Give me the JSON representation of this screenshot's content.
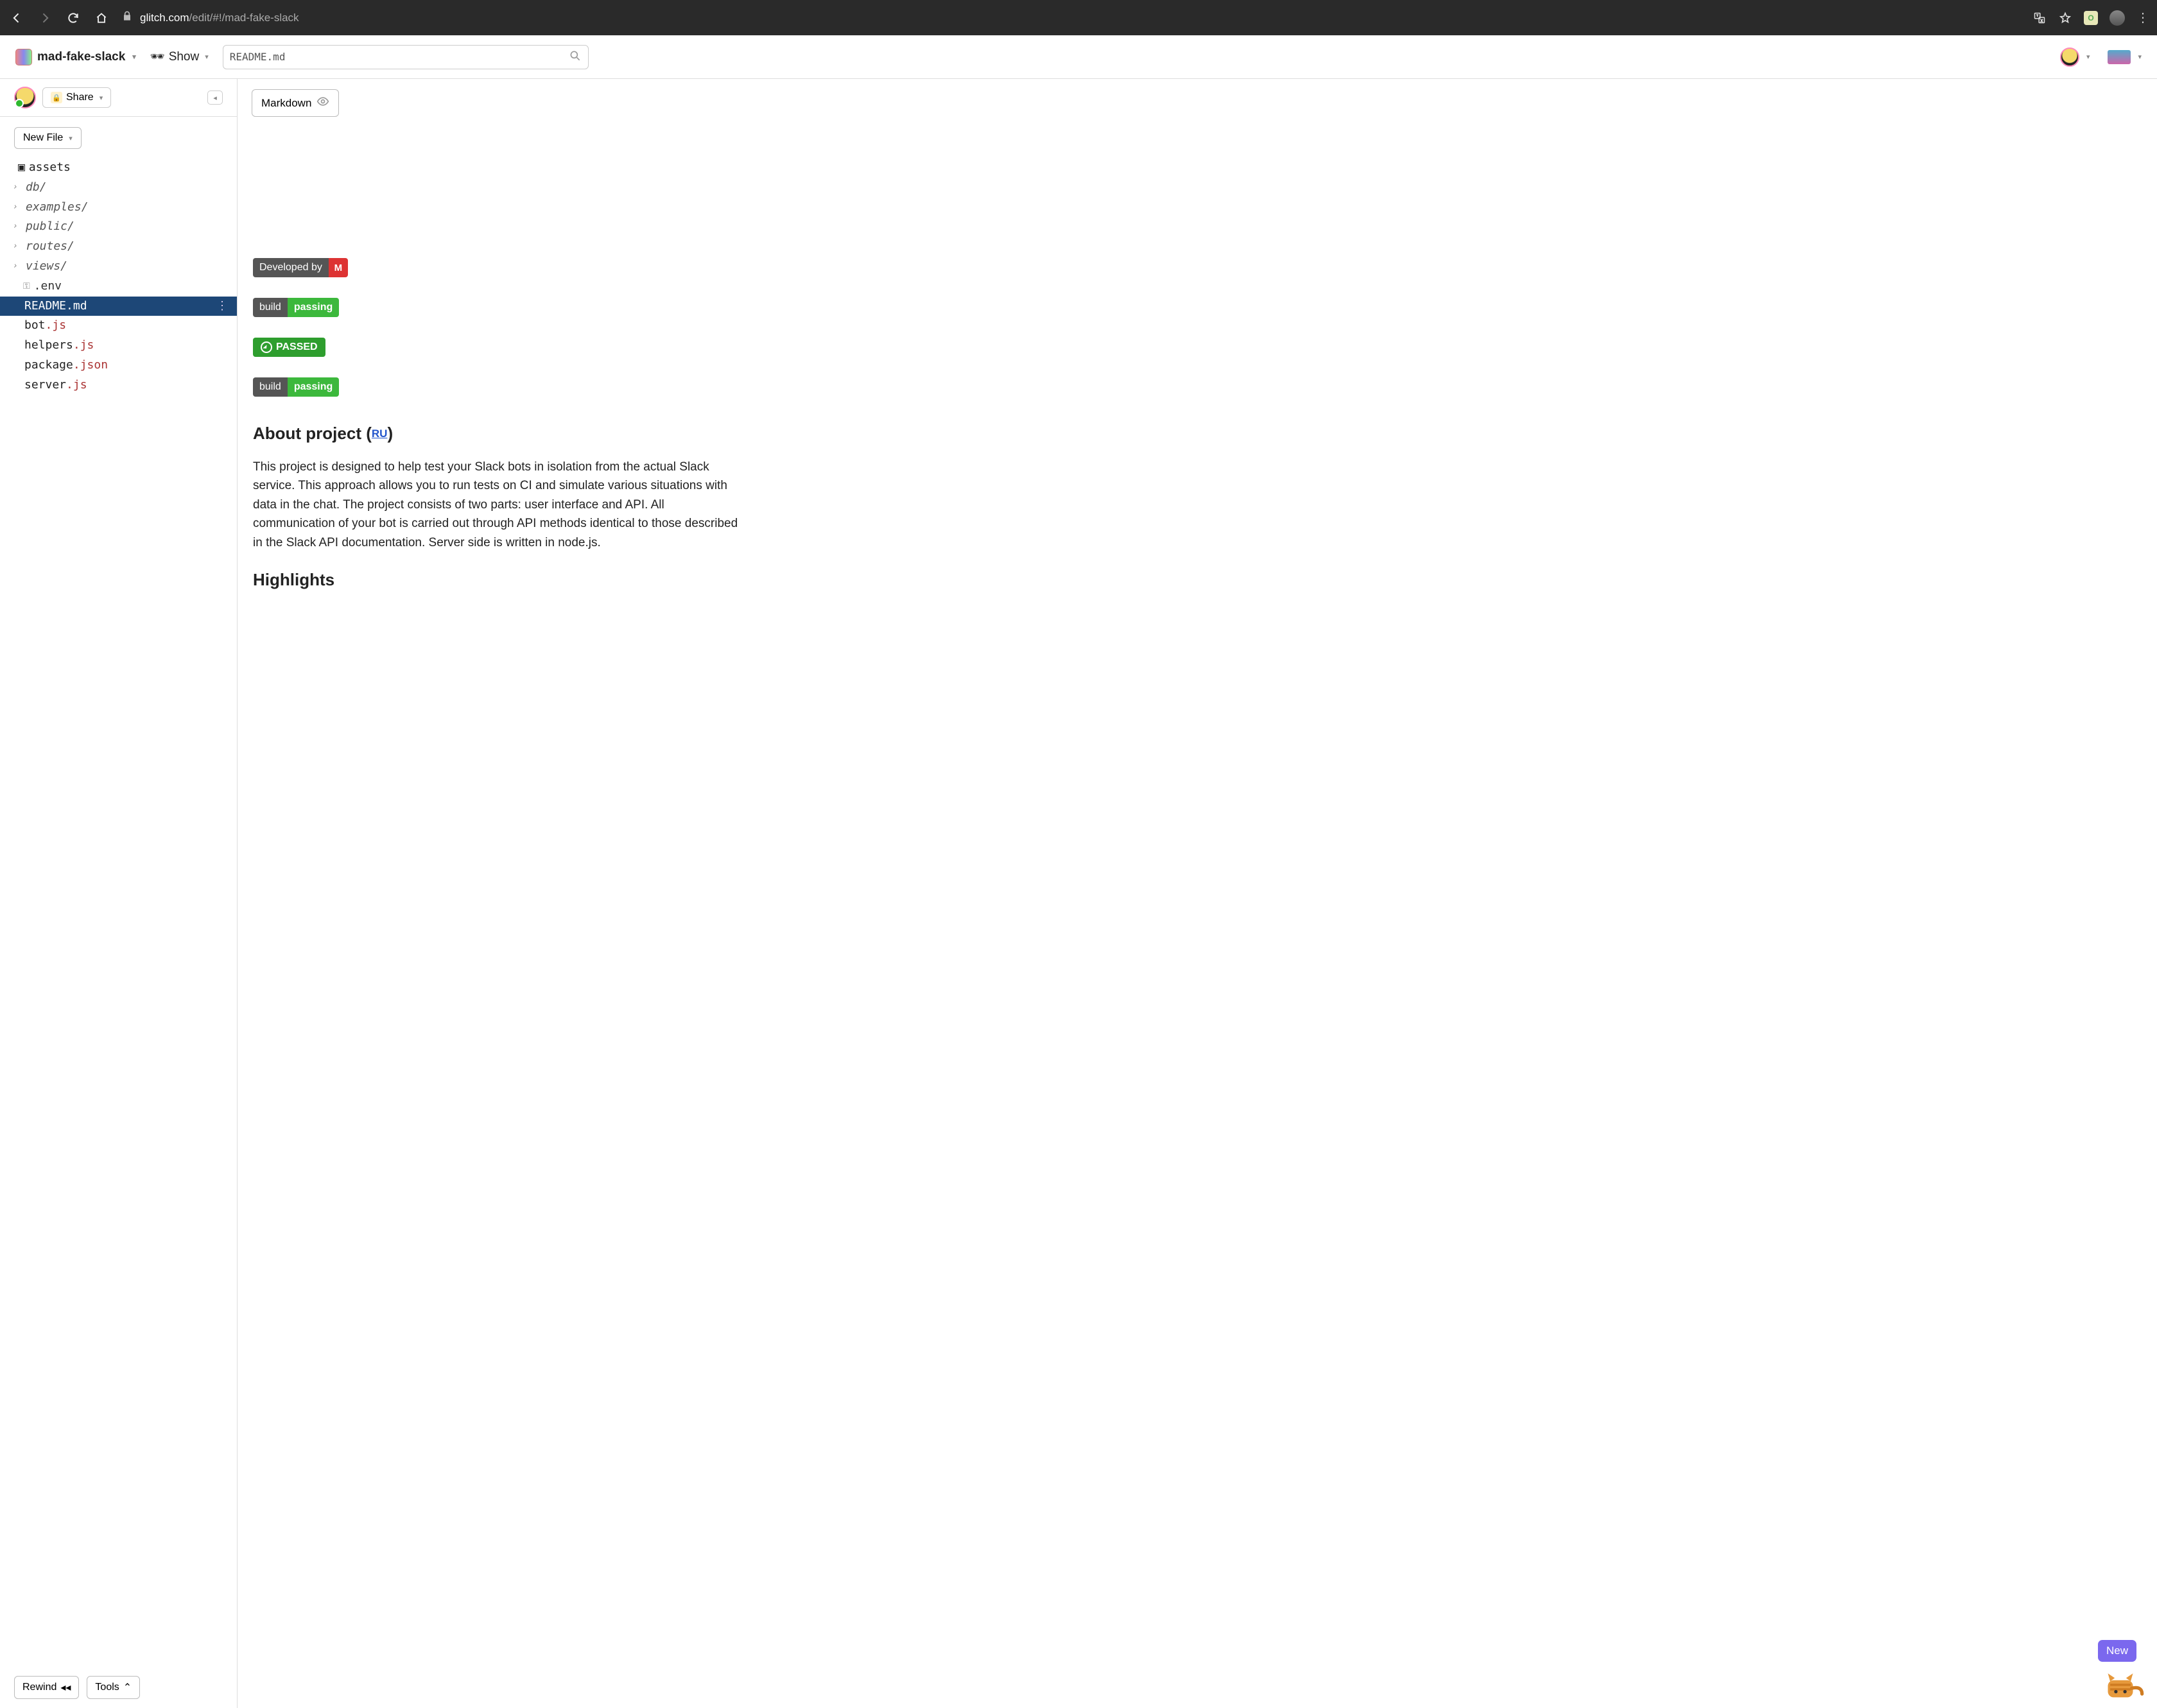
{
  "browser": {
    "url_domain": "glitch.com",
    "url_path": "/edit/#!/mad-fake-slack"
  },
  "app": {
    "project_name": "mad-fake-slack",
    "show_label": "Show",
    "search_value": "README.md"
  },
  "sidebar": {
    "share_label": "Share",
    "new_file_label": "New File",
    "tree": {
      "assets": "assets",
      "folders": [
        "db/",
        "examples/",
        "public/",
        "routes/",
        "views/"
      ],
      "env": ".env",
      "files": [
        "README.md",
        "bot.js",
        "helpers.js",
        "package.json",
        "server.js"
      ],
      "active": "README.md"
    },
    "rewind_label": "Rewind",
    "tools_label": "Tools"
  },
  "content": {
    "markdown_label": "Markdown",
    "badges": {
      "developed_by": "Developed by",
      "developed_by_logo": "M",
      "build": "build",
      "passing": "passing",
      "passed": "PASSED"
    },
    "heading_about_pre": "About project (",
    "heading_about_ru": "RU",
    "heading_about_post": ")",
    "paragraph": "This project is designed to help test your Slack bots in isolation from the actual Slack service. This approach allows you to run tests on CI and simulate various situations with data in the chat. The project consists of two parts: user interface and API. All communication of your bot is carried out through API methods identical to those described in the Slack API documentation. Server side is written in node.js.",
    "heading_highlights": "Highlights",
    "new_label": "New"
  }
}
